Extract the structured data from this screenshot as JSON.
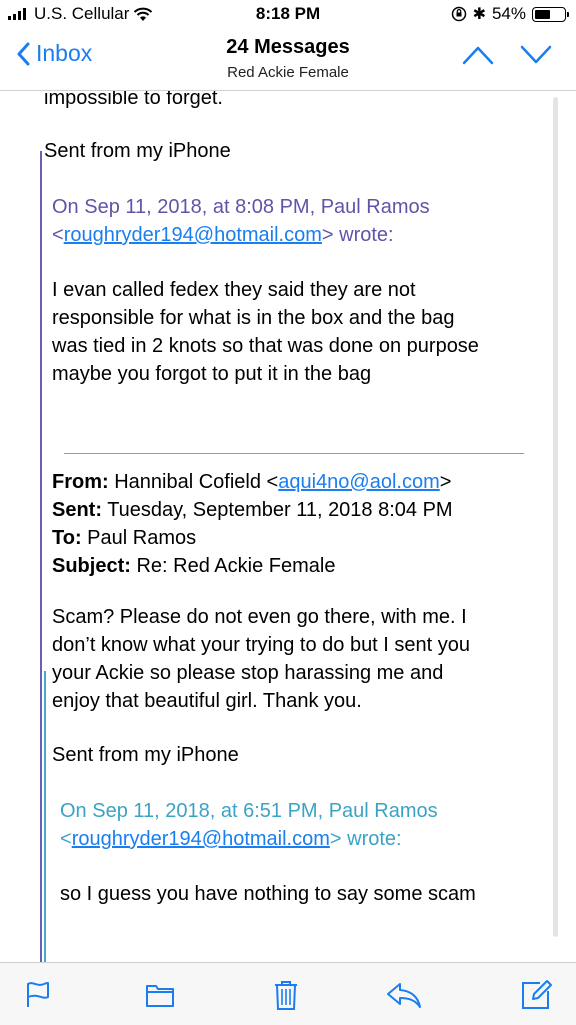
{
  "status_bar": {
    "carrier": "U.S. Cellular",
    "time": "8:18 PM",
    "battery": "54%",
    "battery_level": 0.54
  },
  "nav": {
    "back_label": "Inbox",
    "title": "24 Messages",
    "subtitle": "Red Ackie Female"
  },
  "message": {
    "partial_line": "impossible to forget.",
    "signature1": "Sent from my iPhone",
    "quote1": {
      "header_prefix": "On Sep 11, 2018, at 8:08 PM, Paul Ramos",
      "email": "roughryder194@hotmail.com",
      "header_suffix": "wrote:",
      "body_lines": [
        "I evan called fedex they said they are not",
        "responsible for what is in the box and the bag",
        "was tied in 2 knots so that was done on purpose",
        "maybe you forgot to put it in the bag"
      ]
    },
    "forward": {
      "from_label": "From:",
      "from_name": "Hannibal Cofield",
      "from_email": "aqui4no@aol.com",
      "sent_label": "Sent:",
      "sent_value": "Tuesday, September 11, 2018 8:04 PM",
      "to_label": "To:",
      "to_value": "Paul Ramos",
      "subject_label": "Subject:",
      "subject_value": "Re: Red Ackie Female",
      "body_lines": [
        "Scam? Please do not even go there, with me. I",
        "don’t know what your trying to do but I sent you",
        "your Ackie so please stop harassing me and",
        "enjoy that beautiful girl. Thank you."
      ],
      "signature": "Sent from my iPhone"
    },
    "quote2": {
      "header_prefix": "On Sep 11, 2018, at 6:51 PM, Paul Ramos",
      "email": "roughryder194@hotmail.com",
      "header_suffix": "wrote:",
      "body": "so I guess you have nothing to say some scam"
    }
  },
  "toolbar": {
    "icons": [
      "flag-icon",
      "folder-icon",
      "trash-icon",
      "reply-icon",
      "compose-icon"
    ]
  },
  "colors": {
    "accent": "#1a7ef0",
    "quote1": "#6a5fb6",
    "quote2": "#4aa9c8"
  }
}
